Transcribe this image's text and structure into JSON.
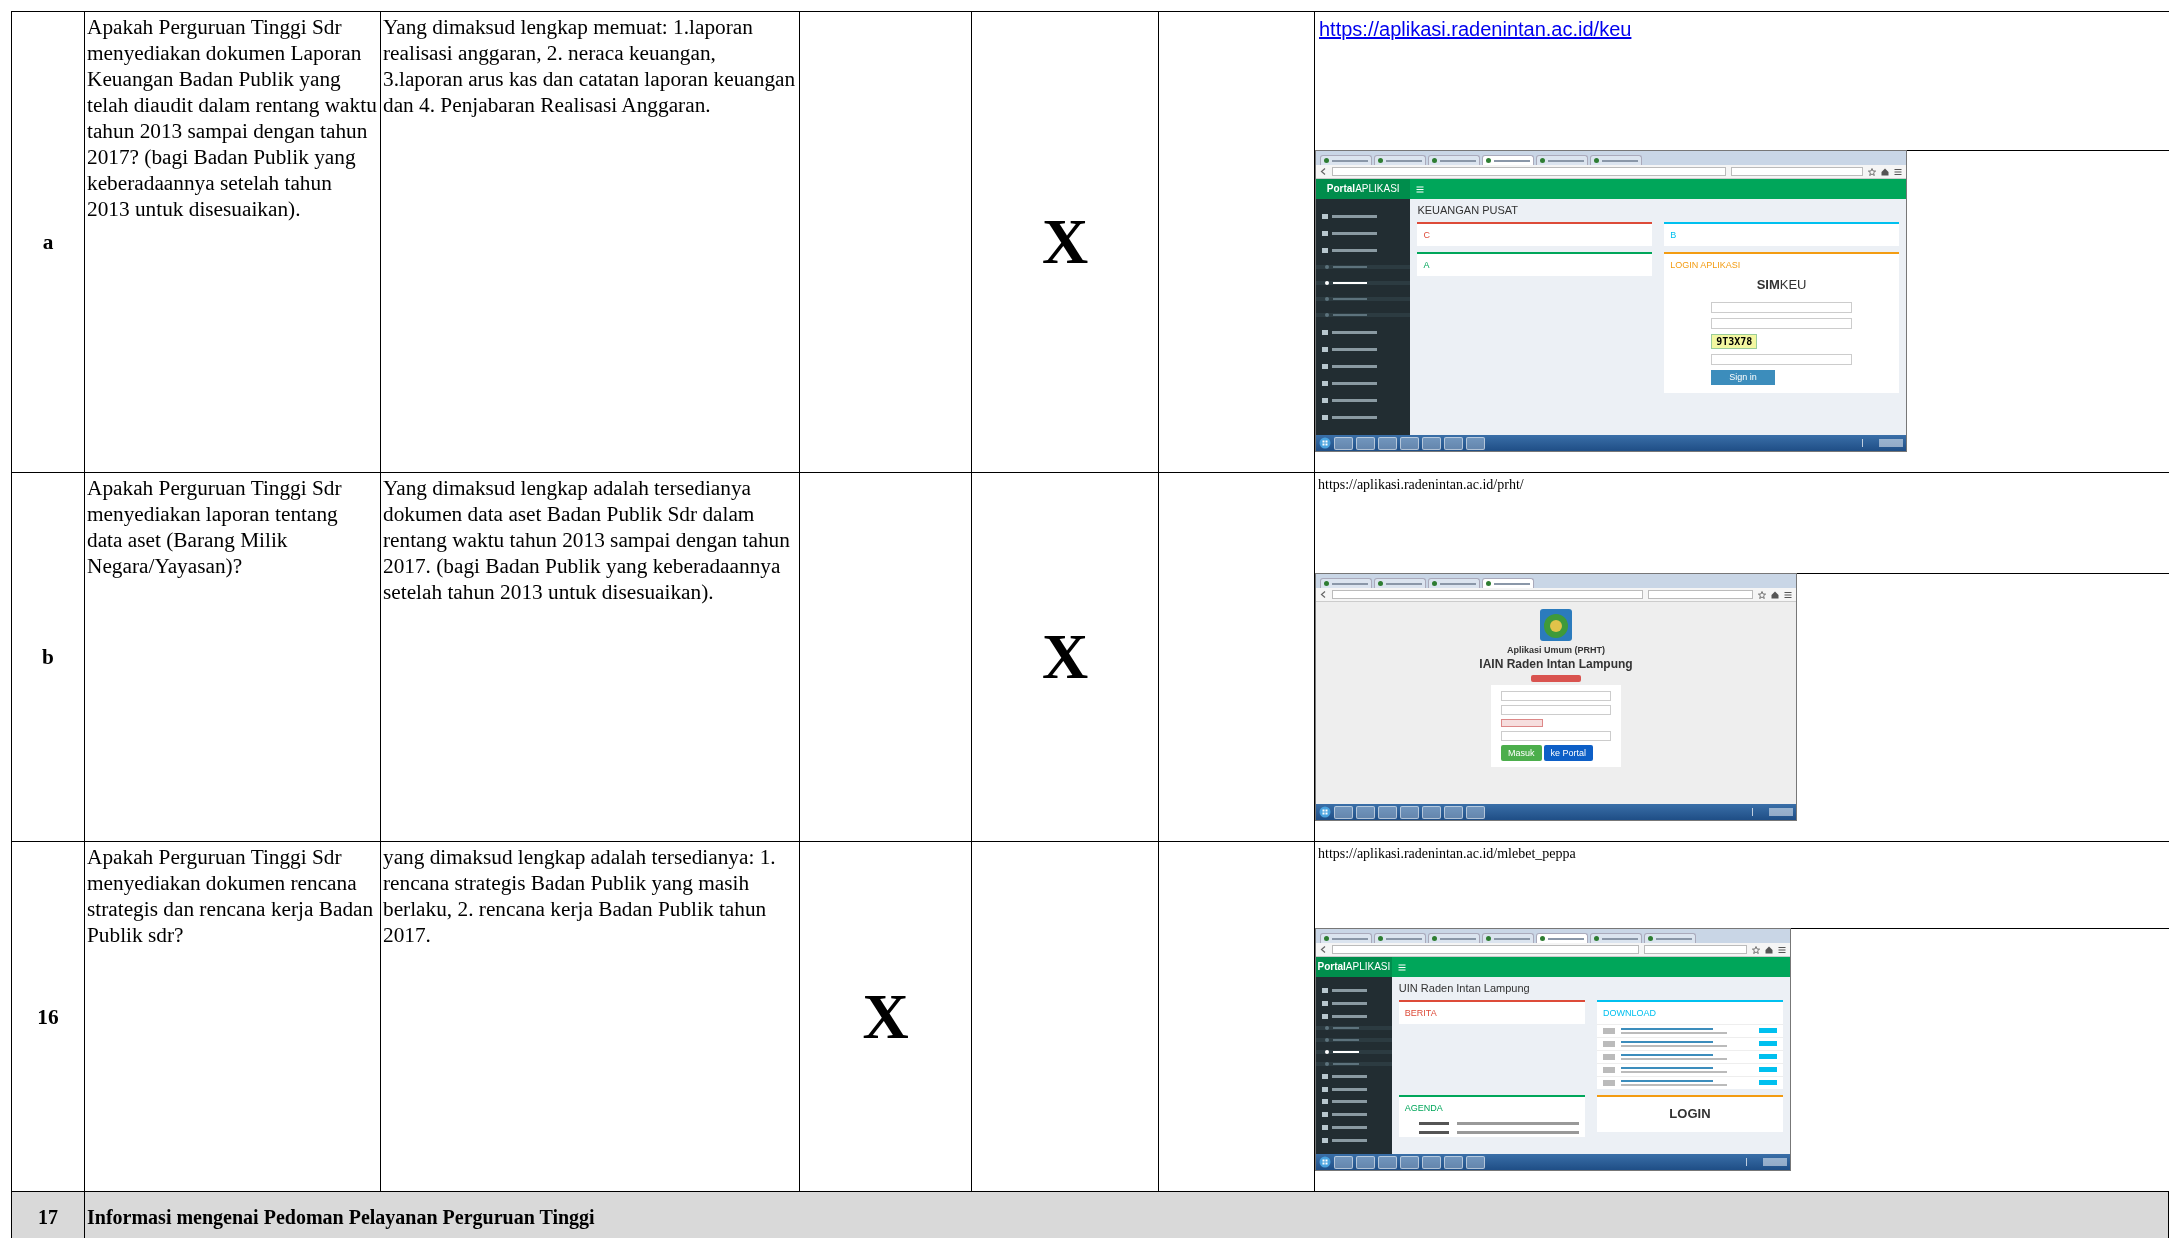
{
  "rows": [
    {
      "kind": "item",
      "no": "a",
      "question": "Apakah Perguruan Tinggi Sdr menyediakan dokumen Laporan Keuangan Badan Publik yang telah diaudit dalam rentang waktu tahun 2013 sampai dengan tahun 2017? (bagi Badan Publik yang keberadaannya setelah tahun 2013 untuk disesuaikan).",
      "explanation": "Yang dimaksud lengkap memuat: 1.laporan realisasi anggaran, 2. neraca keuangan, 3.laporan arus kas dan catatan laporan keuangan dan 4. Penjabaran Realisasi Anggaran.",
      "column_5": "X",
      "evidence": {
        "kind": "hyperlink",
        "url": "https://aplikasi.radenintan.ac.id/keu",
        "screenshot": {
          "kind": "portal",
          "tabs": [
            {
              "selected": false
            },
            {
              "selected": false
            },
            {
              "selected": false
            },
            {
              "selected": true
            },
            {
              "selected": false
            },
            {
              "selected": false
            }
          ],
          "brand": "**Portal**APLIKASI",
          "submenu": [
            {
              "selected": false
            },
            {
              "selected": true
            },
            {
              "selected": false
            },
            {
              "selected": false
            }
          ],
          "page_title": "KEUANGAN PUSAT",
          "panels": [
            {
              "kind": "box",
              "title": "C",
              "color": "#dd4b39"
            },
            {
              "kind": "box",
              "title": "B",
              "color": "#00c0ef"
            },
            {
              "kind": "box",
              "title": "A",
              "color": "#00a65a"
            },
            {
              "kind": "login",
              "title": "LOGIN APLIKASI",
              "color": "#f39c12",
              "logo": "**SIM**KEU",
              "captcha": "9T3X78",
              "button": "Sign in"
            }
          ]
        }
      }
    },
    {
      "kind": "item",
      "no": "b",
      "question": "Apakah Perguruan Tinggi Sdr menyediakan laporan tentang data aset (Barang Milik Negara/Yayasan)?",
      "explanation": "Yang dimaksud lengkap adalah tersedianya dokumen data aset Badan Publik Sdr dalam rentang waktu tahun 2013 sampai dengan tahun 2017. (bagi Badan Publik yang keberadaannya setelah tahun 2013 untuk disesuaikan).",
      "column_5": "X",
      "evidence": {
        "kind": "plain",
        "url": "https://aplikasi.radenintan.ac.id/prht/",
        "screenshot": {
          "kind": "login_page",
          "tabs": [
            {
              "selected": false
            },
            {
              "selected": false
            },
            {
              "selected": false
            },
            {
              "selected": true
            }
          ],
          "app_name": "Aplikasi Umum (PRHT)",
          "institution": "IAIN Raden Intan Lampung",
          "buttons": [
            {
              "label": "Masuk",
              "color": "#4cae4c"
            },
            {
              "label": "ke Portal",
              "color": "#0d5fc7"
            }
          ]
        }
      }
    },
    {
      "kind": "item",
      "no": "16",
      "question": "Apakah Perguruan Tinggi Sdr menyediakan dokumen rencana strategis dan rencana kerja Badan Publik sdr?",
      "explanation": "yang dimaksud lengkap adalah tersedianya: 1. rencana strategis Badan Publik yang masih berlaku, 2. rencana kerja Badan Publik tahun 2017.",
      "column_4": "X",
      "evidence": {
        "kind": "plain",
        "url": "https://aplikasi.radenintan.ac.id/mlebet_peppa",
        "screenshot": {
          "kind": "portal",
          "tabs": [
            {
              "selected": false
            },
            {
              "selected": false
            },
            {
              "selected": false
            },
            {
              "selected": false
            },
            {
              "selected": true
            },
            {
              "selected": false
            },
            {
              "selected": false
            }
          ],
          "brand": "**Portal**APLIKASI",
          "submenu": [
            {
              "selected": false
            },
            {
              "selected": false
            },
            {
              "selected": true
            },
            {
              "selected": false
            }
          ],
          "page_title": "UIN Raden Intan Lampung",
          "panels": [
            {
              "kind": "box",
              "title": "BERITA",
              "color": "#dd4b39"
            },
            {
              "kind": "files",
              "title": "DOWNLOAD",
              "color": "#00c0ef"
            },
            {
              "kind": "agenda",
              "title": "AGENDA",
              "color": "#00a65a"
            },
            {
              "kind": "heading",
              "title": "LOGIN",
              "color": "#f39c12"
            }
          ]
        }
      }
    },
    {
      "kind": "section",
      "no": "17",
      "title": "Informasi mengenai Pedoman Pelayanan Perguruan Tinggi"
    }
  ]
}
